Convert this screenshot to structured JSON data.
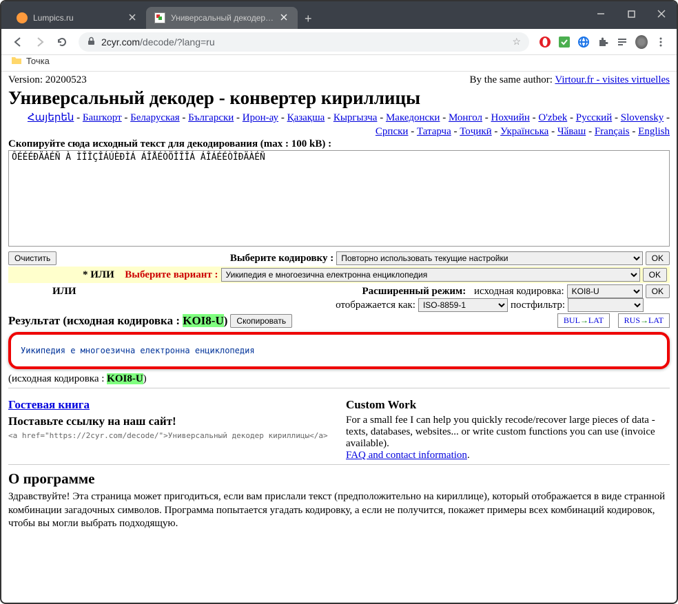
{
  "window": {
    "tabs": [
      {
        "title": "Lumpics.ru",
        "active": false,
        "favicon_color": "#ff9a3c"
      },
      {
        "title": "Универсальный декодер - конв",
        "active": true,
        "favicon_color": "#1a8f3c"
      }
    ]
  },
  "address": {
    "host": "2cyr.com",
    "path": "/decode/?lang=ru"
  },
  "bookmarks": [
    {
      "label": "Точка"
    }
  ],
  "page": {
    "version": "Version: 20200523",
    "by_author_prefix": "By the same author: ",
    "by_author_link": "Virtour.fr - visites virtuelles",
    "title": "Универсальный декодер - конвертер кириллицы",
    "langs": [
      "Հայերեն",
      "Башҡорт",
      "Беларуская",
      "Български",
      "Ирон-ау",
      "Қазақша",
      "Кыргызча",
      "Македонски",
      "Монгол",
      "Нохчийн",
      "O'zbek",
      "Русский",
      "Slovensky",
      "Српски",
      "Татарча",
      "Тоҷикӣ",
      "Українська",
      "Чӑваш",
      "Français",
      "English"
    ],
    "paste_label": "Скопируйте сюда исходный текст для декодирования (max : 100 kB) :",
    "textarea_value": "ÔÉÉÉÐÄÀÉÑ À ÌÎÎÇÎÁÚÈÐÌÁ ÁÎÅÉÒÖÎÎÎÁ ÁÎÁÉÉÒÎÐÄÀÉÑ",
    "clear_btn": "Очистить",
    "select_enc_label": "Выберите кодировку :",
    "select_enc_value": "Повторно использовать текущие настройки",
    "ok_btn": "OK",
    "or_star": "* ИЛИ",
    "choose_variant": "Выберите вариант :",
    "variant_value": "Уикипедия е многоезична електронна енциклопедия",
    "or2": "ИЛИ",
    "adv_label": "Расширенный режим:",
    "src_enc_label": "исходная кодировка:",
    "src_enc_value": "KOI8-U",
    "display_as_label": "отображается как:",
    "display_as_value": "ISO-8859-1",
    "postfilter_label": "постфильтр:",
    "postfilter_value": "",
    "result_label_prefix": "Результат (исходная кодировка : ",
    "result_enc": "KOI8-U",
    "result_label_suffix": ")",
    "copy_btn": "Скопировать",
    "translit1": {
      "a": "BUL",
      "b": "LAT"
    },
    "translit2": {
      "a": "RUS",
      "b": "LAT"
    },
    "result_text": "Уикипедия е многоезична електронна енциклопедия",
    "src_enc_repeat_prefix": "(исходная кодировка : ",
    "src_enc_repeat_value": "KOI8-U",
    "src_enc_repeat_suffix": ")",
    "guestbook": "Гостевая книга",
    "linkus_label": "Поставьте ссылку на наш сайт!",
    "linkus_code": "<a href=\"https://2cyr.com/decode/\">Универсальный декодер кириллицы</a>",
    "custom_title": "Custom Work",
    "custom_text": "For a small fee I can help you quickly recode/recover large pieces of data - texts, databases, websites... or write custom functions you can use (invoice available).",
    "custom_link": "FAQ and contact information",
    "about_title": "О программе",
    "about_text": "Здравствуйте! Эта страница может пригодиться, если вам прислали текст (предположительно на кириллице), который отображается в виде странной комбинации загадочных символов. Программа попытается угадать кодировку, а если не получится, покажет примеры всех комбинаций кодировок, чтобы вы могли выбрать подходящую."
  }
}
